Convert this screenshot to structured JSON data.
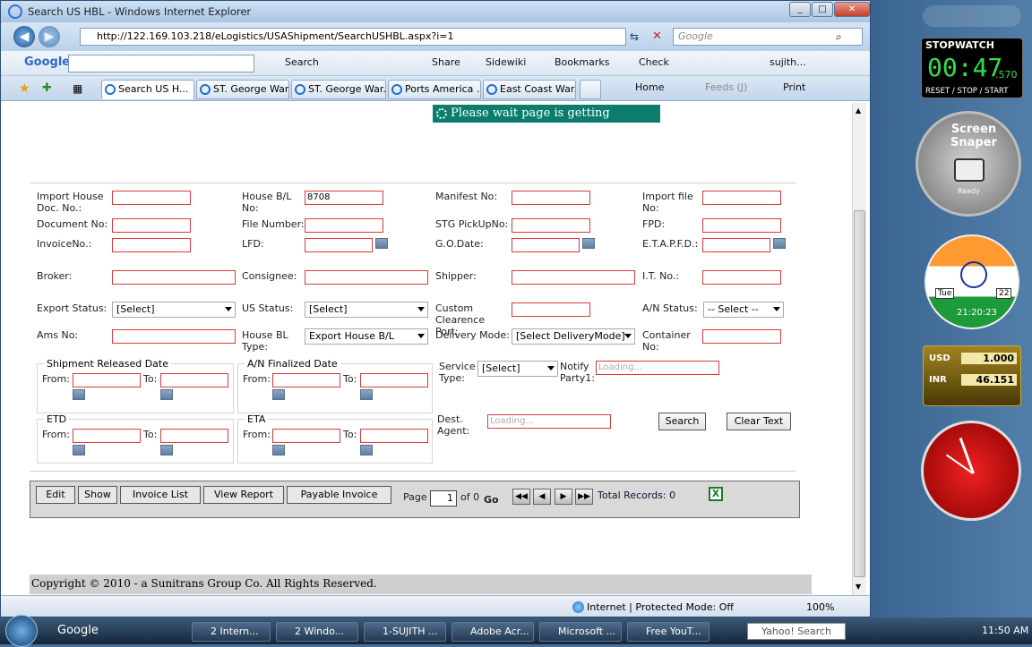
{
  "window": {
    "title": "Search US HBL - Windows Internet Explorer",
    "min": "_",
    "max": "□",
    "close": "✕"
  },
  "address": {
    "url": "http://122.169.103.218/eLogistics/USAShipment/SearchUSHBL.aspx?i=1",
    "search_placeholder": "Google"
  },
  "google_toolbar": {
    "logo": "Google",
    "search": "Search",
    "share": "Share",
    "sidewiki": "Sidewiki",
    "bookmarks": "Bookmarks",
    "check": "Check",
    "user": "sujith..."
  },
  "tabs": [
    {
      "label": "Search US H..."
    },
    {
      "label": "ST. George War..."
    },
    {
      "label": "ST. George War..."
    },
    {
      "label": "Ports America ..."
    },
    {
      "label": "East Coast War..."
    }
  ],
  "command_bar": {
    "home": "Home",
    "feeds": "Feeds (J)",
    "print": "Print"
  },
  "page": {
    "loading_banner": "Please wait page is getting loaded....",
    "labels": {
      "import_house_doc": "Import House Doc. No.:",
      "house_bl": "House B/L No:",
      "manifest_no": "Manifest No:",
      "import_file": "Import file No:",
      "document_no": "Document No:",
      "file_number": "File Number:",
      "stg_pickup": "STG PickUpNo:",
      "fpd": "FPD:",
      "invoice_no": "InvoiceNo.:",
      "lfd": "LFD:",
      "go_date": "G.O.Date:",
      "etapfd": "E.T.A.P.F.D.:",
      "broker": "Broker:",
      "consignee": "Consignee:",
      "shipper": "Shipper:",
      "it_no": "I.T. No.:",
      "export_status": "Export Status:",
      "us_status": "US Status:",
      "custom_clearance": "Custom Clearence Port:",
      "an_status": "A/N Status:",
      "ams_no": "Ams No:",
      "house_bl_type": "House BL Type:",
      "delivery_mode": "Delivery Mode:",
      "container_no": "Container No:",
      "service_type": "Service Type:",
      "notify_party": "Notify Party1:",
      "dest_agent": "Dest. Agent:"
    },
    "values": {
      "house_bl": "8708",
      "export_status": "[Select]",
      "us_status": "[Select]",
      "an_status": "-- Select --",
      "house_bl_type": "Export House B/L",
      "delivery_mode": "[Select DeliveryMode]",
      "service_type": "[Select]",
      "notify_party_placeholder": "Loading...",
      "dest_agent_placeholder": "Loading..."
    },
    "groups": {
      "shipment_released": "Shipment Released Date",
      "an_finalized": "A/N Finalized Date",
      "etd": "ETD",
      "eta": "ETA",
      "from": "From:",
      "to": "To:"
    },
    "buttons": {
      "search": "Search",
      "clear": "Clear Text"
    },
    "actions": {
      "edit": "Edit",
      "show": "Show",
      "invoice_list": "Invoice List",
      "view_report": "View Report",
      "payable_invoice": "Payable Invoice"
    },
    "pager": {
      "page_label": "Page",
      "page_value": "1",
      "of": "of 0",
      "go": "Go",
      "total": "Total Records: 0"
    },
    "copyright": "Copyright © 2010 - a Sunitrans Group Co. All Rights Reserved."
  },
  "statusbar": {
    "zone": "Internet | Protected Mode: Off",
    "zoom": "100%"
  },
  "taskbar": {
    "google": "Google",
    "items": [
      "2 Intern...",
      "2 Windo...",
      "1-SUJITH ...",
      "Adobe Acr...",
      "Microsoft ...",
      "Free YouT..."
    ],
    "yahoo": "Yahoo! Search",
    "clock": "11:50 AM"
  },
  "gadgets": {
    "stopwatch_title": "STOPWATCH",
    "stopwatch_time": "00:47",
    "stopwatch_ms": ".570",
    "stopwatch_controls": "RESET / STOP / START",
    "snaper": "Screen Snaper",
    "snaper_status": "Ready",
    "clock_day": "Tue",
    "clock_date": "22",
    "clock_time": "21:20:23",
    "fx_from": "USD",
    "fx_from_val": "1.000",
    "fx_to": "INR",
    "fx_to_val": "46.151"
  }
}
